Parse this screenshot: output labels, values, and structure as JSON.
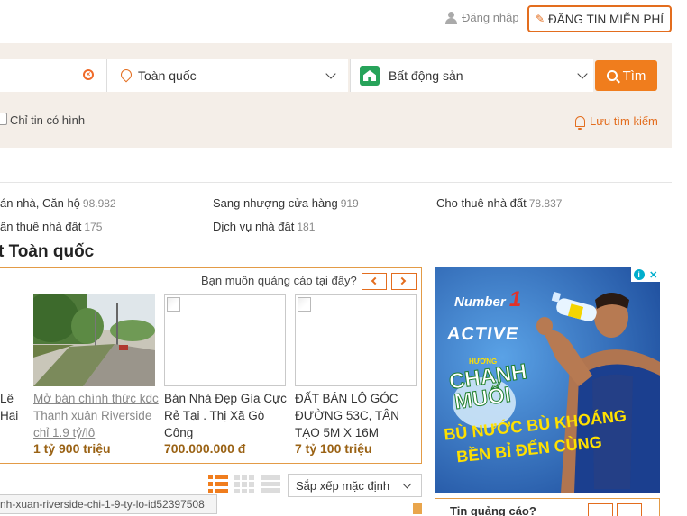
{
  "header": {
    "login_label": "Đăng nhập",
    "post_label": "ĐĂNG TIN MIỄN PHÍ",
    "accent_color": "#e36d1e"
  },
  "search": {
    "location_value": "Toàn quốc",
    "category_value": "Bất động sản",
    "search_button": "Tìm",
    "image_only_label": "Chỉ tin có hình",
    "save_search_label": "Lưu tìm kiếm"
  },
  "categories": [
    {
      "label": "án nhà, Căn hộ",
      "count": "98.982"
    },
    {
      "label": "Sang nhượng cửa hàng",
      "count": "919"
    },
    {
      "label": "Cho thuê nhà đất",
      "count": "78.837"
    },
    {
      "label": "ần thuê nhà đất",
      "count": "175"
    },
    {
      "label": "Dịch vụ nhà đất",
      "count": "181"
    }
  ],
  "section_heading": "t Toàn quốc",
  "promo": {
    "ad_question": "Bạn muốn quảng cáo tại đây?",
    "partial_title": [
      "Lê",
      "Hai"
    ],
    "listings": [
      {
        "title": "Mở bán chính thức kdc Thạnh xuân Riverside chỉ 1.9 tỷ/lô",
        "price": "1 tỷ 900 triệu",
        "visited": true
      },
      {
        "title": "Bán Nhà Đẹp Gía Cực Rẻ Tại . Thị Xã Gò Công",
        "price": "700.000.000 đ",
        "visited": false
      },
      {
        "title": "ĐẤT BÁN LÔ GÓC ĐƯỜNG 53C, TÂN TẠO 5M X 16M",
        "price": "7 tỷ 100 triệu",
        "visited": false
      }
    ]
  },
  "ad_banner": {
    "brand_number": "1",
    "brand_word": "Number",
    "line1": "ACTIVE",
    "flavor_small": "HƯƠNG",
    "flavor1": "CHANH",
    "flavor2": "MUỐI",
    "slogan1": "BÙ NƯỚC BÙ KHOÁNG",
    "slogan2": "BỀN BỈ ĐẾN CÙNG"
  },
  "listing_tools": {
    "sort_value": "Sắp xếp mặc định"
  },
  "status_url": "nh-xuan-riverside-chi-1-9-ty-lo-id52397508",
  "ad_box2_title": "Tin quảng cáo?"
}
